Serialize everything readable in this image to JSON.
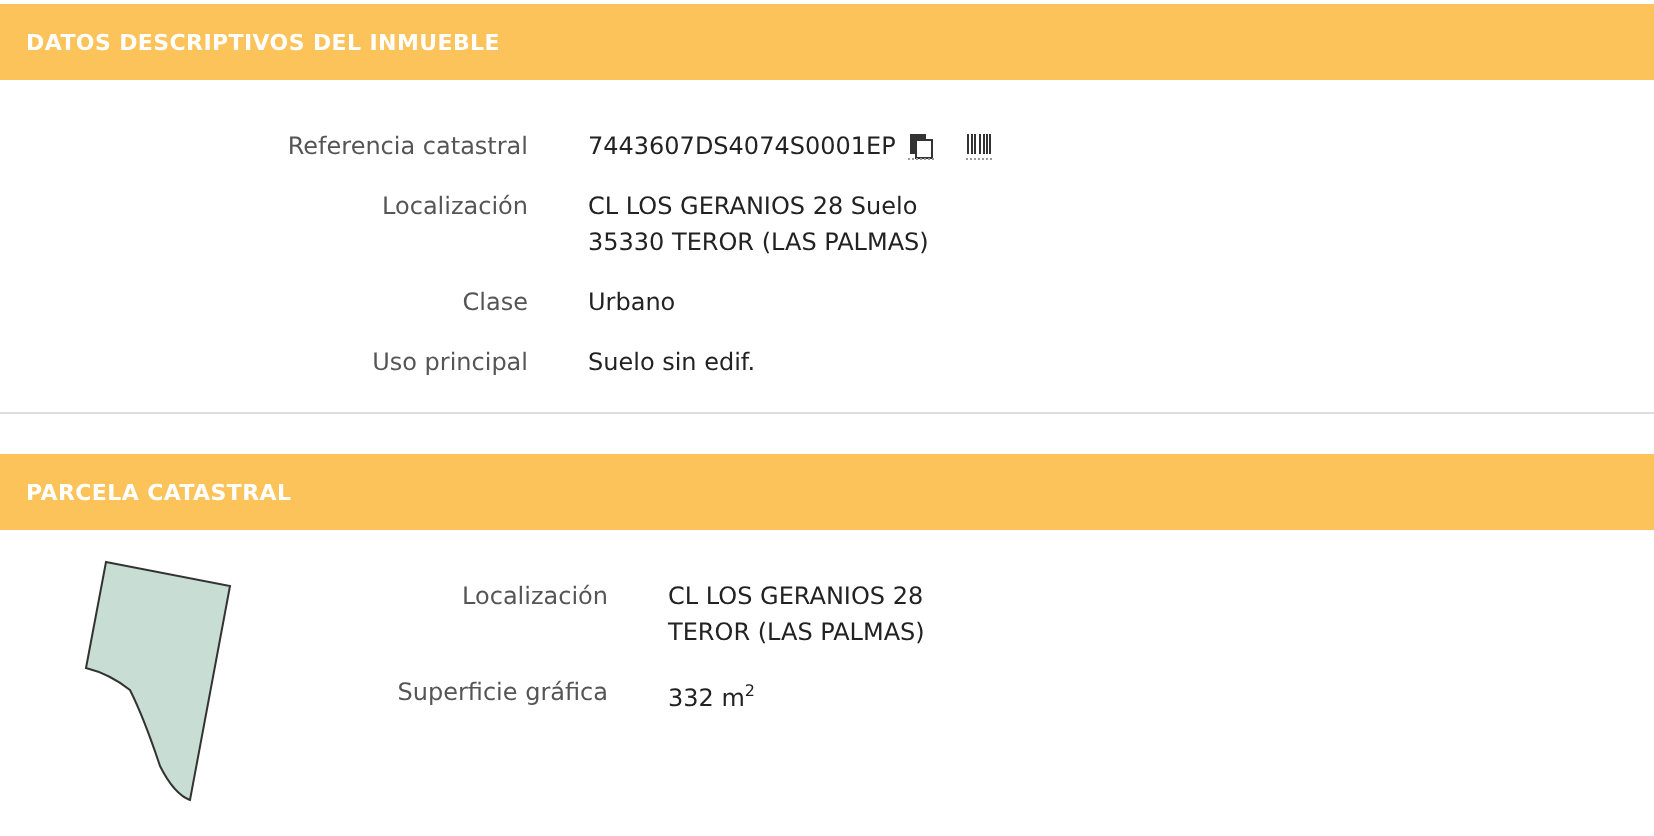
{
  "sections": [
    {
      "kind": "details",
      "title": "DATOS DESCRIPTIVOS DEL INMUEBLE",
      "rows": [
        {
          "label": "Referencia catastral",
          "lines": [
            "7443607DS4074S0001EP"
          ],
          "tools": true
        },
        {
          "label": "Localización",
          "lines": [
            "CL LOS GERANIOS 28 Suelo",
            "35330 TEROR (LAS PALMAS)"
          ],
          "tools": false
        },
        {
          "label": "Clase",
          "lines": [
            "Urbano"
          ],
          "tools": false
        },
        {
          "label": "Uso principal",
          "lines": [
            "Suelo sin edif."
          ],
          "tools": false
        }
      ]
    },
    {
      "kind": "parcel",
      "title": "PARCELA CATASTRAL",
      "rows": [
        {
          "label": "Localización",
          "lines": [
            "CL LOS GERANIOS 28",
            "TEROR (LAS PALMAS)"
          ],
          "tools": false
        },
        {
          "label": "Superficie gráfica",
          "lines": [
            "332 m$^{2}$"
          ],
          "tools": false
        }
      ]
    }
  ]
}
